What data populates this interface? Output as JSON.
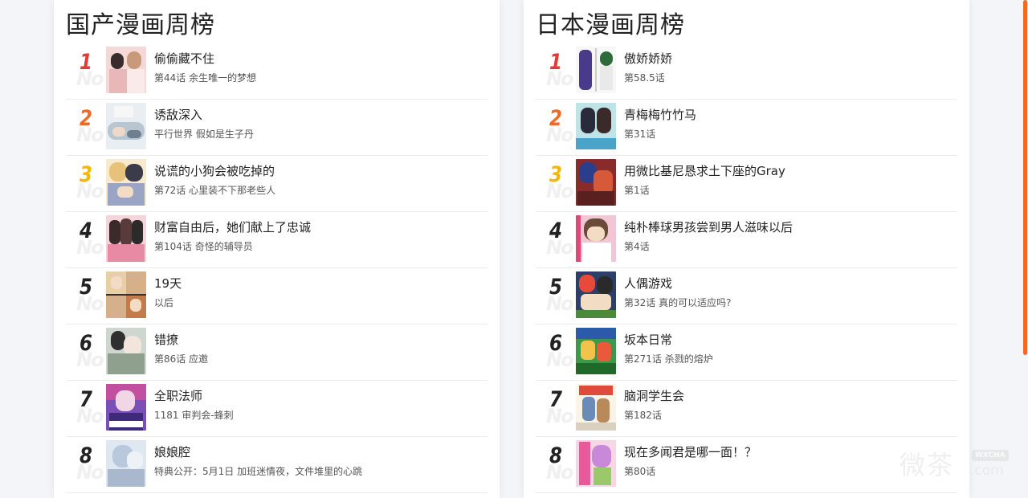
{
  "colors": {
    "rank1": "#e53935",
    "rank2": "#f26a22",
    "rank3": "#f5b800",
    "rank_other": "#222222",
    "scrollbar": "#f26a22"
  },
  "left_panel": {
    "title": "国产漫画周榜",
    "items": [
      {
        "rank": "1",
        "title": "偷偷藏不住",
        "subtitle": "第44话 余生唯一的梦想"
      },
      {
        "rank": "2",
        "title": "诱敌深入",
        "subtitle": "平行世界 假如是生子丹"
      },
      {
        "rank": "3",
        "title": "说谎的小狗会被吃掉的",
        "subtitle": "第72话 心里装不下那老些人"
      },
      {
        "rank": "4",
        "title": "财富自由后，她们献上了忠诚",
        "subtitle": "第104话 奇怪的辅导员"
      },
      {
        "rank": "5",
        "title": "19天",
        "subtitle": "以后"
      },
      {
        "rank": "6",
        "title": "错撩",
        "subtitle": "第86话 应邀"
      },
      {
        "rank": "7",
        "title": "全职法师",
        "subtitle": "1181 审判会-蜂刺"
      },
      {
        "rank": "8",
        "title": "娘娘腔",
        "subtitle": "特典公开：5月1日 加班迷情夜，文件堆里的心跳"
      }
    ]
  },
  "right_panel": {
    "title": "日本漫画周榜",
    "items": [
      {
        "rank": "1",
        "title": "傲娇娇娇",
        "subtitle": "第58.5话"
      },
      {
        "rank": "2",
        "title": "青梅梅竹竹马",
        "subtitle": "第31话"
      },
      {
        "rank": "3",
        "title": "用微比基尼恳求土下座的Gray",
        "subtitle": "第1话"
      },
      {
        "rank": "4",
        "title": "纯朴棒球男孩尝到男人滋味以后",
        "subtitle": "第4话"
      },
      {
        "rank": "5",
        "title": "人偶游戏",
        "subtitle": "第32话 真的可以适应吗?"
      },
      {
        "rank": "6",
        "title": "坂本日常",
        "subtitle": "第271话 杀戮的熔炉"
      },
      {
        "rank": "7",
        "title": "脑洞学生会",
        "subtitle": "第182话"
      },
      {
        "rank": "8",
        "title": "现在多闻君是哪一面！？",
        "subtitle": "第80话"
      }
    ]
  },
  "watermark": {
    "text_cn": "微茶",
    "badge": "WXCHA",
    "domain": ".com"
  }
}
